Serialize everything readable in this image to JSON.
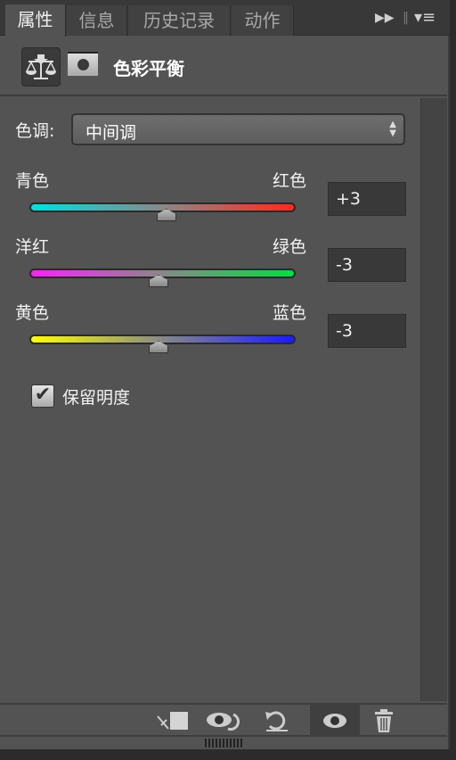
{
  "tabs": [
    {
      "label": "属性",
      "active": true
    },
    {
      "label": "信息"
    },
    {
      "label": "历史记录"
    },
    {
      "label": "动作"
    }
  ],
  "tab_icons": {
    "expand": "double-arrow-right-icon",
    "menu": "panel-menu-icon"
  },
  "header": {
    "title": "色彩平衡",
    "adjustment_icon": "balance-scale-icon",
    "mask_icon": "layer-mask-icon"
  },
  "tone": {
    "label": "色调:",
    "value": "中间调"
  },
  "sliders": [
    {
      "left": "青色",
      "right": "红色",
      "value": "+3",
      "level": 3,
      "range": [
        -100,
        100
      ],
      "colors": [
        "#00e0e0",
        "#ff2a1a"
      ]
    },
    {
      "left": "洋红",
      "right": "绿色",
      "value": "-3",
      "level": -3,
      "range": [
        -100,
        100
      ],
      "colors": [
        "#ff20ff",
        "#00e040"
      ]
    },
    {
      "left": "黄色",
      "right": "蓝色",
      "value": "-3",
      "level": -3,
      "range": [
        -100,
        100
      ],
      "colors": [
        "#ffff00",
        "#1a1aff"
      ]
    }
  ],
  "preserve_luminosity": {
    "label": "保留明度",
    "checked": true
  },
  "toolbar": [
    "clip-to-layer-icon",
    "view-previous-state-icon",
    "reset-icon",
    "visibility-eye-icon",
    "trash-icon"
  ]
}
